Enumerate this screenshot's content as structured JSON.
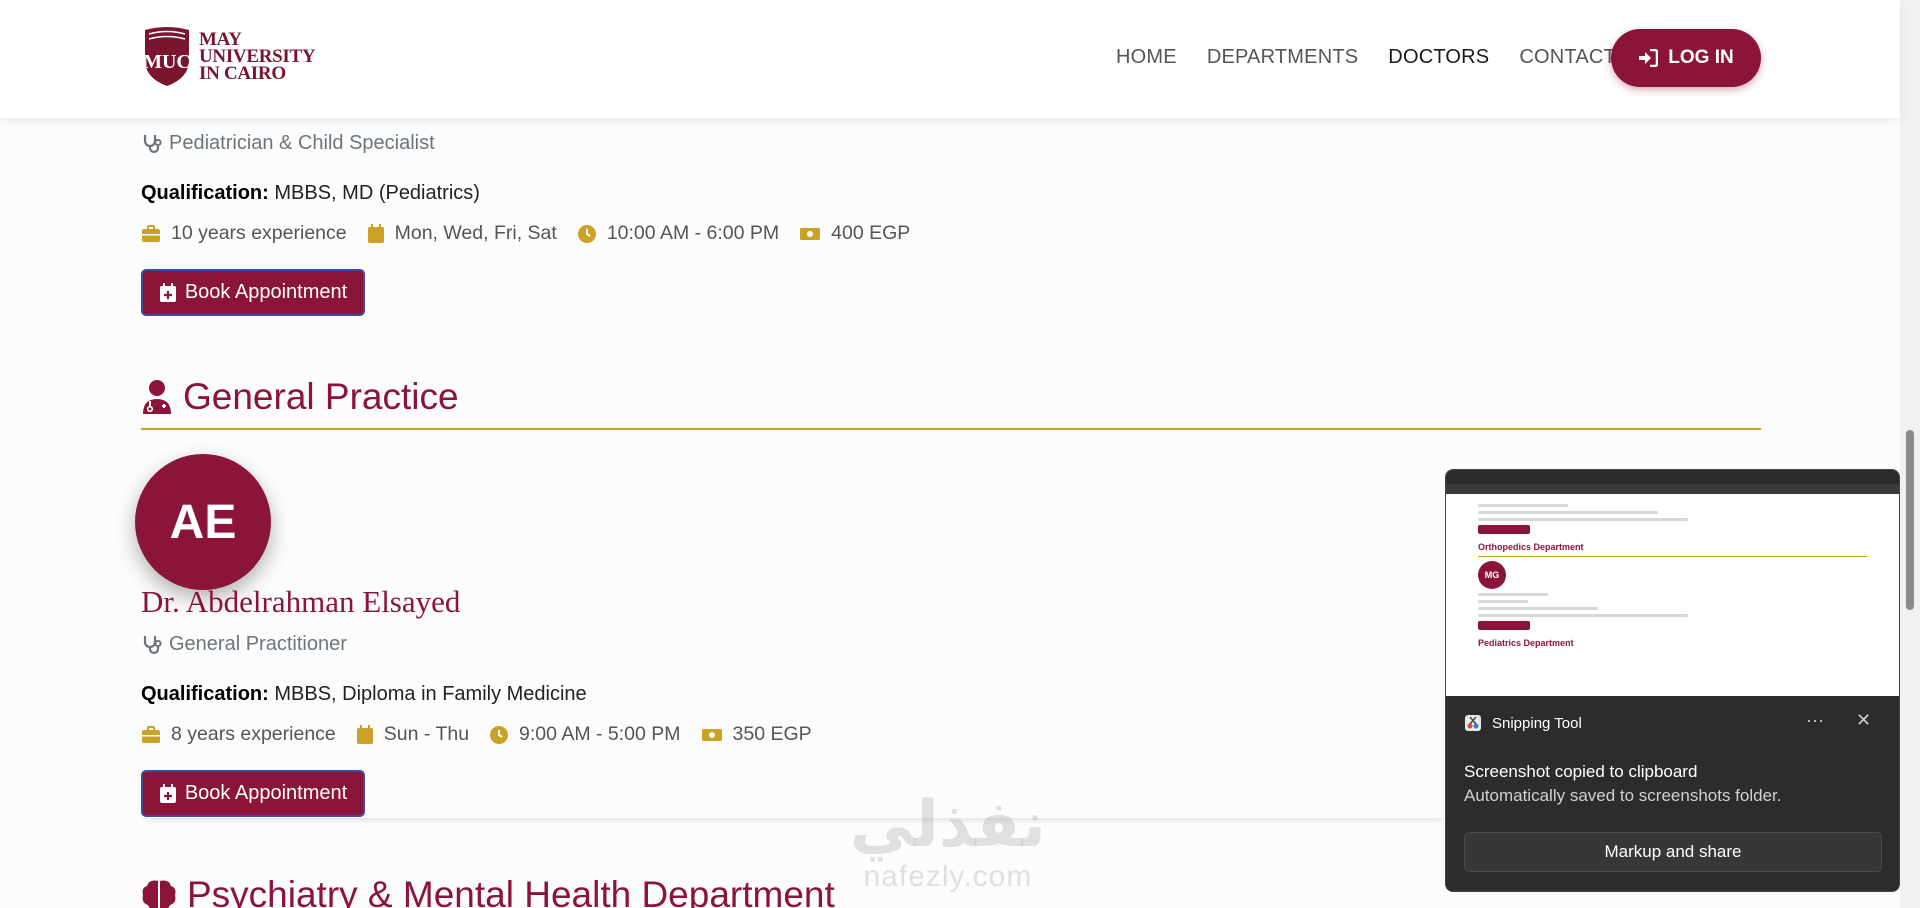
{
  "header": {
    "logo_lines": [
      "MAY",
      "UNIVERSITY",
      "IN CAIRO"
    ],
    "logo_monogram": "MUC",
    "nav": [
      {
        "label": "HOME",
        "active": false
      },
      {
        "label": "DEPARTMENTS",
        "active": false
      },
      {
        "label": "DOCTORS",
        "active": true
      },
      {
        "label": "CONTACT",
        "active": false
      }
    ],
    "login_label": "LOG IN",
    "brand_color": "#8b1538",
    "accent_color": "#c9a227"
  },
  "doctor_prev": {
    "specialty": "Pediatrician & Child Specialist",
    "qualification_label": "Qualification:",
    "qualification": "MBBS, MD (Pediatrics)",
    "experience": "10 years experience",
    "days": "Mon, Wed, Fri, Sat",
    "hours": "10:00 AM - 6:00 PM",
    "fee": "400 EGP",
    "book_label": "Book Appointment"
  },
  "section_general": {
    "title": "General Practice",
    "icon": "user-doctor-icon"
  },
  "doctor_ae": {
    "initials": "AE",
    "name": "Dr. Abdelrahman Elsayed",
    "specialty": "General Practitioner",
    "qualification_label": "Qualification:",
    "qualification": "MBBS, Diploma in Family Medicine",
    "experience": "8 years experience",
    "days": "Sun - Thu",
    "hours": "9:00 AM - 5:00 PM",
    "fee": "350 EGP",
    "book_label": "Book Appointment"
  },
  "section_psych": {
    "title": "Psychiatry & Mental Health Department",
    "icon": "brain-icon"
  },
  "watermark": {
    "arabic": "نفذلي",
    "latin": "nafezly.com"
  },
  "snip_preview": {
    "heading1": "Orthopedics Department",
    "avatar": "MG",
    "heading2": "Pediatrics Department"
  },
  "snip_toast": {
    "app": "Snipping Tool",
    "more": "···",
    "close": "✕",
    "title": "Screenshot copied to clipboard",
    "subtitle": "Automatically saved to screenshots folder.",
    "action": "Markup and share"
  }
}
